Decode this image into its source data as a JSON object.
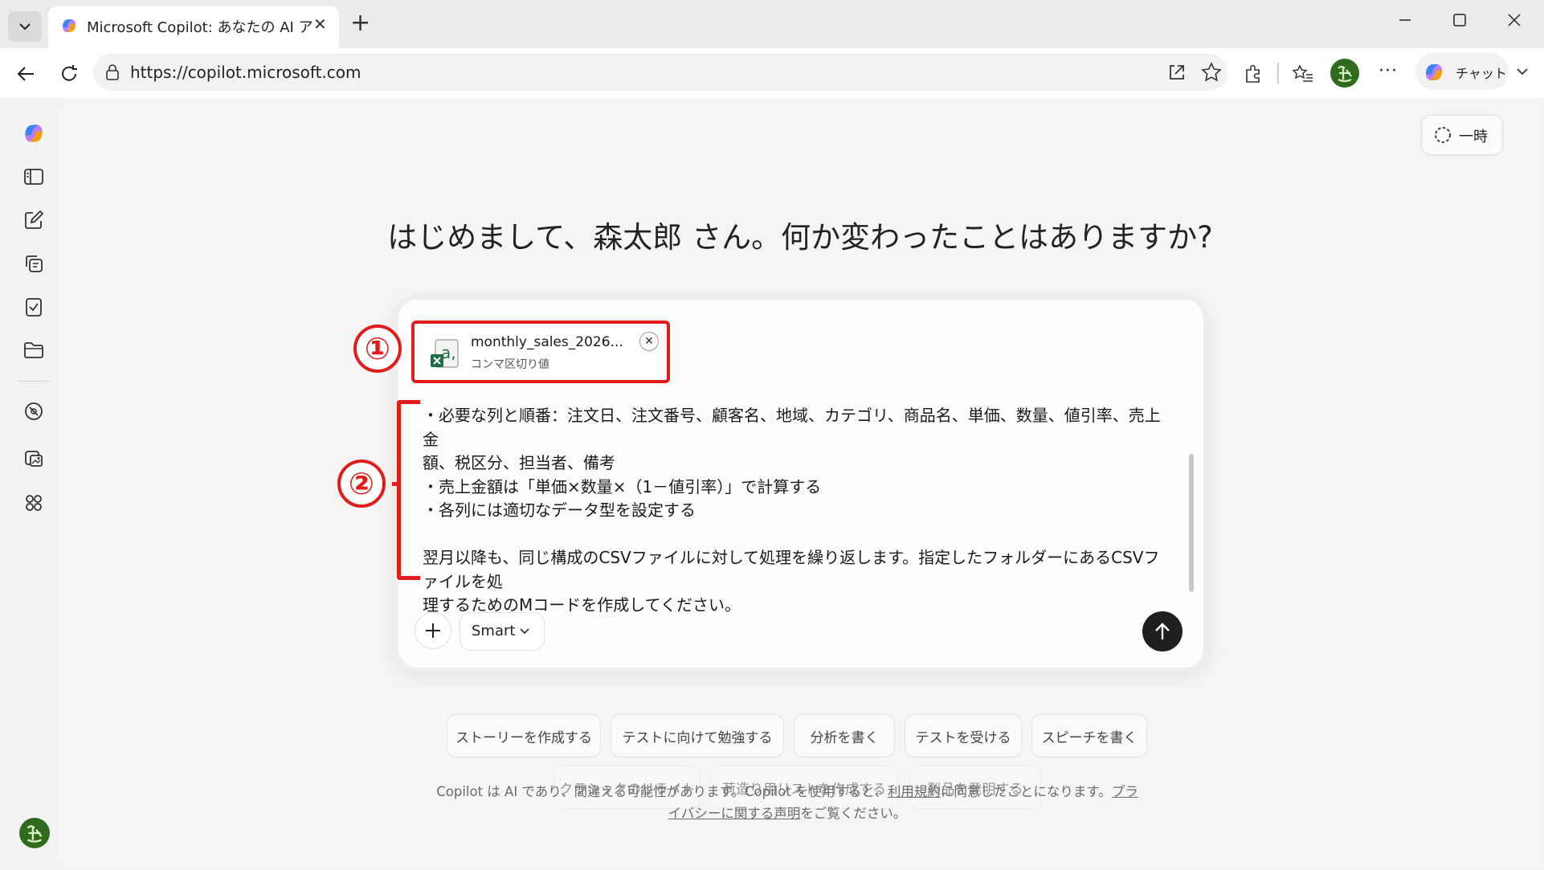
{
  "browser": {
    "tab_title": "Microsoft Copilot: あなたの AI アシスタント",
    "url": "https://copilot.microsoft.com",
    "chat_button_label": "チャット"
  },
  "header": {
    "temp_button_label": "一時"
  },
  "greeting": "はじめまして、森太郎 さん。何か変わったことはありますか?",
  "composer": {
    "attachment": {
      "file_name": "monthly_sales_2026...",
      "file_type": "コンマ区切り値"
    },
    "message_lines": [
      "・必要な列と順番：注文日、注文番号、顧客名、地域、カテゴリ、商品名、単価、数量、値引率、売上金",
      "額、税区分、担当者、備考",
      "・売上金額は「単価×数量×（1－値引率）」で計算する",
      "・各列には適切なデータ型を設定する",
      "",
      "翌月以降も、同じ構成のCSVファイルに対して処理を繰り返します。指定したフォルダーにあるCSVファイルを処",
      "理するためのMコードを作成してください。"
    ],
    "mode_label": "Smart"
  },
  "markers": {
    "one": "①",
    "two": "②"
  },
  "suggestions": [
    "ストーリーを作成する",
    "テストに向けて勉強する",
    "分析を書く",
    "テストを受ける",
    "スピーチを書く",
    "クラシックのリライト",
    "荷造り用リストを作成する",
    "製品を発明する"
  ],
  "disclaimer": {
    "part1": "Copilot は AI であり、間違える可能性があります。Copilot を使用すると、",
    "terms_link": "利用規約",
    "part2": "に同意したことになります。",
    "privacy_link": "プライバシーに関する声明",
    "part3": "をご覧ください。"
  },
  "colors": {
    "annotation_red": "#e21b1b",
    "send_button": "#1f1f1f",
    "page_background": "#f7f5f3"
  }
}
